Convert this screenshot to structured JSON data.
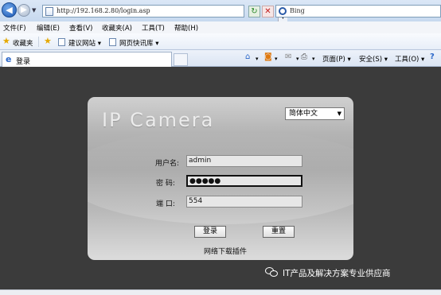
{
  "browser": {
    "url": "http://192.168.2.80/login.asp",
    "search_placeholder": "Bing",
    "menu": [
      "文件(F)",
      "编辑(E)",
      "查看(V)",
      "收藏夹(A)",
      "工具(T)",
      "帮助(H)"
    ],
    "favorites_label": "收藏夹",
    "favorites_links": [
      "建议网站 ▾",
      "网页快讯库 ▾"
    ],
    "tab_title": "登录",
    "commands": {
      "page": "页面(P) ▾",
      "safety": "安全(S) ▾",
      "tools": "工具(O) ▾"
    }
  },
  "login": {
    "title": "IP Camera",
    "language": "简体中文",
    "labels": {
      "username": "用户名:",
      "password": "密  码:",
      "port": "端  口:"
    },
    "values": {
      "username": "admin",
      "password": "●●●●●",
      "port": "554"
    },
    "buttons": {
      "login": "登录",
      "reset": "重置"
    },
    "plugin": {
      "before": "网络下载",
      "mark": "",
      "after": "插件"
    }
  },
  "watermark": "IT产品及解决方案专业供应商"
}
